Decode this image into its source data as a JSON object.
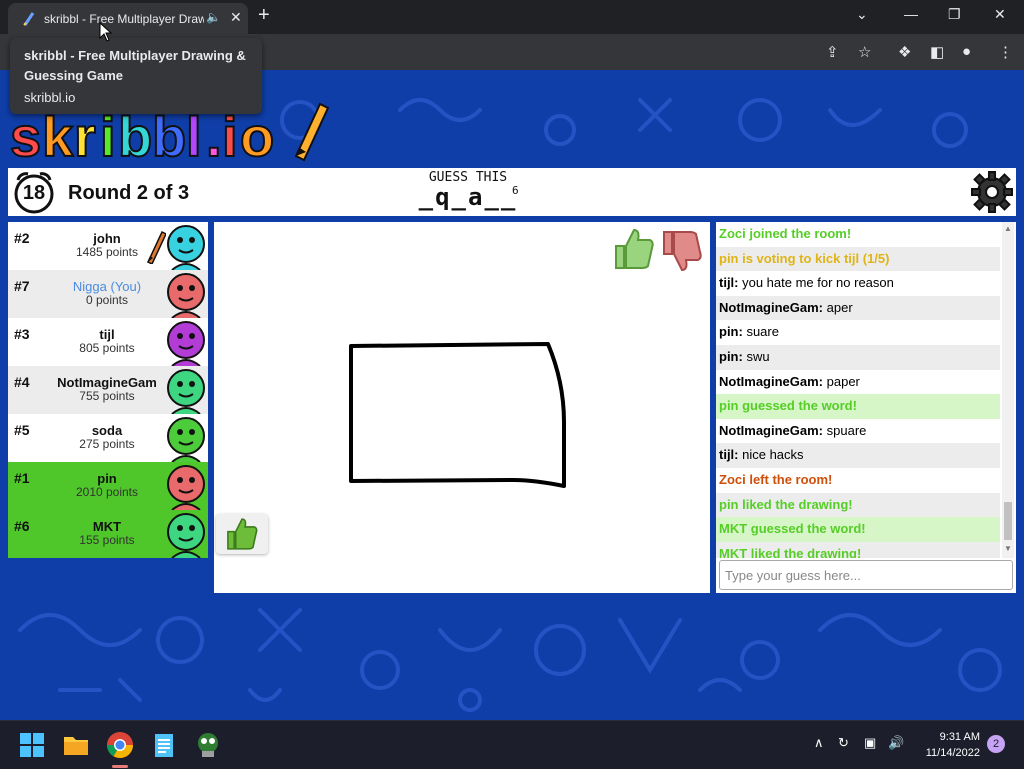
{
  "browser": {
    "tab_title": "skribbl - Free Multiplayer Drawing & Guessing Game",
    "tooltip_title": "skribbl - Free Multiplayer Drawing & Guessing Game",
    "tooltip_url": "skribbl.io"
  },
  "game": {
    "timer": "18",
    "round": "Round 2 of 3",
    "guess_label": "GUESS THIS",
    "word_hint": "_q_a__",
    "word_length": "6"
  },
  "players": [
    {
      "rank": "#2",
      "name": "john",
      "points": "1485 points",
      "bg": "#ffffff",
      "avatar": "#38d1e0",
      "drawing": true
    },
    {
      "rank": "#7",
      "name": "Nigga (You)",
      "points": "0 points",
      "bg": "#ececec",
      "avatar": "#e86a6a",
      "you": true
    },
    {
      "rank": "#3",
      "name": "tijl",
      "points": "805 points",
      "bg": "#ffffff",
      "avatar": "#b43cd6"
    },
    {
      "rank": "#4",
      "name": "NotImagineGam",
      "points": "755 points",
      "bg": "#ececec",
      "avatar": "#3ed680"
    },
    {
      "rank": "#5",
      "name": "soda",
      "points": "275 points",
      "bg": "#ffffff",
      "avatar": "#4ccc3a"
    },
    {
      "rank": "#1",
      "name": "pin",
      "points": "2010 points",
      "bg": "#4fc72a",
      "avatar": "#e86a6a"
    },
    {
      "rank": "#6",
      "name": "MKT",
      "points": "155 points",
      "bg": "#4fc72a",
      "avatar": "#3ed680"
    }
  ],
  "chat": {
    "messages": [
      {
        "text": "Zoci joined the room!",
        "style": "green"
      },
      {
        "text": "pin is voting to kick tijl (1/5)",
        "style": "gold",
        "alt": true
      },
      {
        "user": "tijl:",
        "text": " you hate me for no reason"
      },
      {
        "user": "NotImagineGam:",
        "text": " aper",
        "alt": true
      },
      {
        "user": "pin:",
        "text": " suare"
      },
      {
        "user": "pin:",
        "text": " swu",
        "alt": true
      },
      {
        "user": "NotImagineGam:",
        "text": " paper"
      },
      {
        "text": "pin guessed the word!",
        "style": "green",
        "greenbg": true
      },
      {
        "user": "NotImagineGam:",
        "text": " spuare"
      },
      {
        "user": "tijl:",
        "text": " nice hacks",
        "alt": true
      },
      {
        "text": "Zoci left the room!",
        "style": "red"
      },
      {
        "text": "pin liked the drawing!",
        "style": "green",
        "alt": true
      },
      {
        "text": "MKT guessed the word!",
        "style": "green",
        "greenbg": true
      },
      {
        "text": "MKT liked the drawing!",
        "style": "green",
        "alt": true
      }
    ],
    "input_placeholder": "Type your guess here..."
  },
  "taskbar": {
    "time": "9:31 AM",
    "date": "11/14/2022",
    "notifications": "2"
  }
}
